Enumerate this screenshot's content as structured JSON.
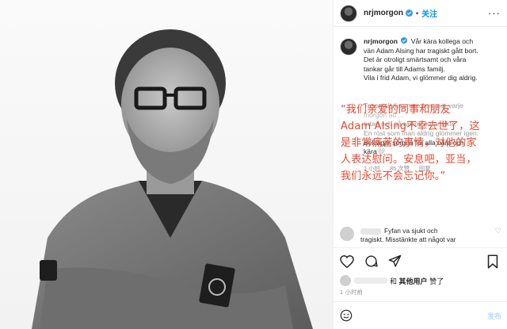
{
  "header": {
    "username": "nrjmorgon",
    "separator": "•",
    "follow_label": "关注",
    "more_icon": "more-horizontal-icon"
  },
  "caption": {
    "username": "nrjmorgon",
    "lines": [
      "Vår kära kollega och",
      "vän Adam Alsing har tragiskt gått bort.",
      "Det är otroligt smärtsamt och våra",
      "tankar går till Adams familj.",
      "Vila i frid Adam, vi glömmer dig aldrig.",
      "",
      "",
      "Tusentals lyssnare kommer varje",
      "morgon att ...",
      "rutan och gå radion ett ansikte.",
      "En röst som man aldrig glömmer igen.",
      "Beklagar sorgen för alla nära och",
      "kära🤍"
    ]
  },
  "overlay": {
    "lines": [
      "“我们亲爱的同事和朋友",
      "Adam Alsing不幸去世了，这",
      "是非常痛苦的事情，对他的家",
      "人表达慰问。安息吧，亚当，",
      "我们永远不会忘记你。”"
    ]
  },
  "meta": {
    "age": "1 小时",
    "likes": "85 次赞",
    "reply": "回复"
  },
  "reply_comment": {
    "text_line1": "Fyfan va sjukt och",
    "text_line2": "tragiskt. Misstänkte att något var"
  },
  "likes_row": {
    "connector": "和",
    "others": "其他用户",
    "suffix": "赞了"
  },
  "post_age": "1 小时前",
  "comment_box": {
    "placeholder": "",
    "post_label": "发布"
  },
  "icons": {
    "like": "heart-icon",
    "comment": "comment-icon",
    "share": "share-icon",
    "save": "bookmark-icon",
    "emoji": "emoji-icon"
  },
  "colors": {
    "accent": "#0095f6",
    "overlay_text": "#e8472f",
    "verified": "#3897f0"
  }
}
